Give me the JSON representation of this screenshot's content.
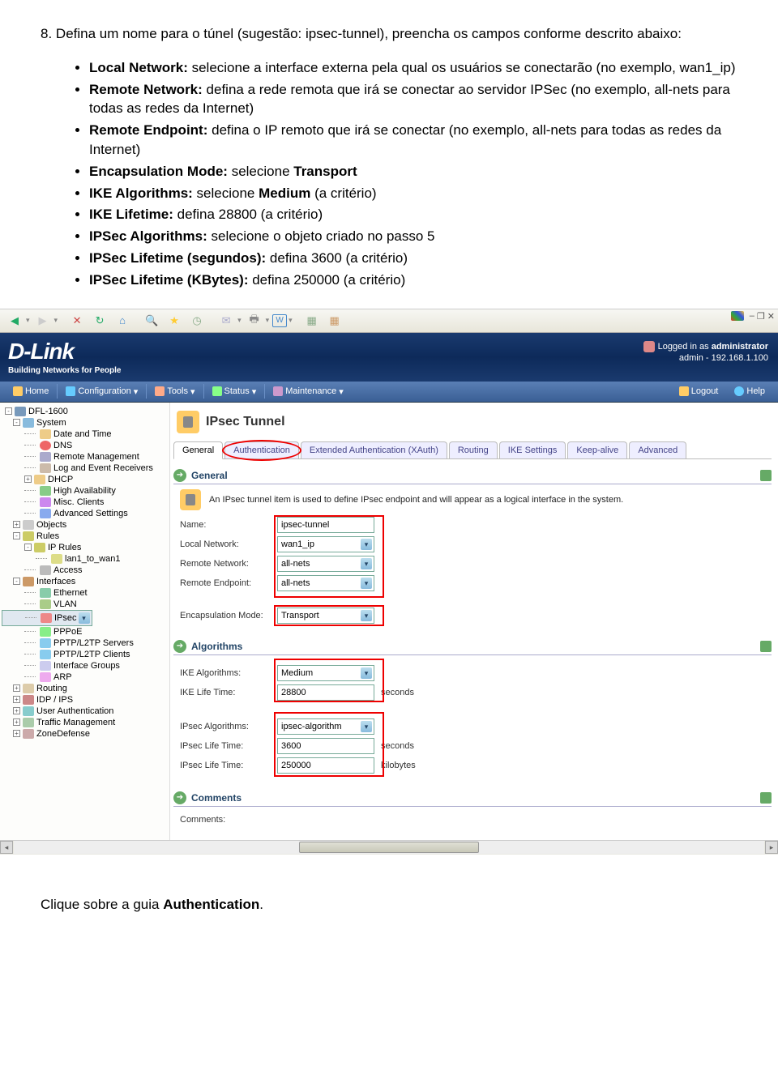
{
  "doc": {
    "step_num": "8.",
    "step_text": "Defina um nome para o túnel (sugestão: ipsec-tunnel), preencha os campos conforme descrito abaixo:",
    "bullets": [
      {
        "b": "Local Network:",
        "t": " selecione a interface externa pela qual os usuários se conectarão (no exemplo, wan1_ip)"
      },
      {
        "b": "Remote Network:",
        "t": " defina a rede remota que irá se conectar ao servidor IPSec (no exemplo, all-nets para todas as redes da Internet)"
      },
      {
        "b": "Remote Endpoint:",
        "t": " defina o IP remoto que irá se conectar (no exemplo, all-nets para todas as redes da Internet)"
      },
      {
        "b": "Encapsulation Mode:",
        "t": " selecione ",
        "b2": "Transport"
      },
      {
        "b": "IKE Algorithms:",
        "t": " selecione ",
        "b2": "Medium",
        "t2": " (a critério)"
      },
      {
        "b": "IKE Lifetime:",
        "t": " defina 28800 (a critério)"
      },
      {
        "b": "IPSec Algorithms:",
        "t": " selecione o objeto criado no passo 5"
      },
      {
        "b": "IPSec Lifetime (segundos):",
        "t": " defina 3600 (a critério)"
      },
      {
        "b": "IPSec Lifetime (KBytes):",
        "t": " defina 250000 (a critério)"
      }
    ],
    "footer": "Clique sobre a guia ",
    "footer_b": "Authentication",
    "footer_end": "."
  },
  "toolbar": {
    "w_label": "W"
  },
  "header": {
    "brand": "D-Link",
    "tagline": "Building Networks for People",
    "logged_in": "Logged in as ",
    "user": "administrator",
    "admin_ip": "admin - 192.168.1.100"
  },
  "nav": {
    "home": "Home",
    "config": "Configuration",
    "tools": "Tools",
    "status": "Status",
    "maint": "Maintenance",
    "logout": "Logout",
    "help": "Help"
  },
  "tree": {
    "root": "DFL-1600",
    "system": "System",
    "date": "Date and Time",
    "dns": "DNS",
    "remote": "Remote Management",
    "log": "Log and Event Receivers",
    "dhcp": "DHCP",
    "ha": "High Availability",
    "misc": "Misc. Clients",
    "adv": "Advanced Settings",
    "objects": "Objects",
    "rules": "Rules",
    "iprules": "IP Rules",
    "lanrule": "lan1_to_wan1",
    "access": "Access",
    "interfaces": "Interfaces",
    "ethernet": "Ethernet",
    "vlan": "VLAN",
    "ipsec": "IPsec",
    "pppoe": "PPPoE",
    "pptps": "PPTP/L2TP Servers",
    "pptpc": "PPTP/L2TP Clients",
    "ifg": "Interface Groups",
    "arp": "ARP",
    "routing": "Routing",
    "idp": "IDP / IPS",
    "userauth": "User Authentication",
    "traffic": "Traffic Management",
    "zone": "ZoneDefense"
  },
  "page": {
    "title": "IPsec Tunnel",
    "tabs": {
      "general": "General",
      "auth": "Authentication",
      "xauth": "Extended Authentication (XAuth)",
      "routing": "Routing",
      "ike": "IKE Settings",
      "keepalive": "Keep-alive",
      "advanced": "Advanced"
    },
    "sec_general": "General",
    "info_text": "An IPsec tunnel item is used to define IPsec endpoint and will appear as a logical interface in the system.",
    "labels": {
      "name": "Name:",
      "local": "Local Network:",
      "remote_net": "Remote Network:",
      "remote_ep": "Remote Endpoint:",
      "encap": "Encapsulation Mode:",
      "ike_alg": "IKE Algorithms:",
      "ike_life": "IKE Life Time:",
      "ipsec_alg": "IPsec Algorithms:",
      "ipsec_life1": "IPsec Life Time:",
      "ipsec_life2": "IPsec Life Time:",
      "comments": "Comments:"
    },
    "values": {
      "name": "ipsec-tunnel",
      "local": "wan1_ip",
      "remote_net": "all-nets",
      "remote_ep": "all-nets",
      "encap": "Transport",
      "ike_alg": "Medium",
      "ike_life": "28800",
      "ipsec_alg": "ipsec-algorithm",
      "ipsec_life1": "3600",
      "ipsec_life2": "250000"
    },
    "units": {
      "seconds": "seconds",
      "kb": "kilobytes"
    },
    "sec_algorithms": "Algorithms",
    "sec_comments": "Comments"
  }
}
